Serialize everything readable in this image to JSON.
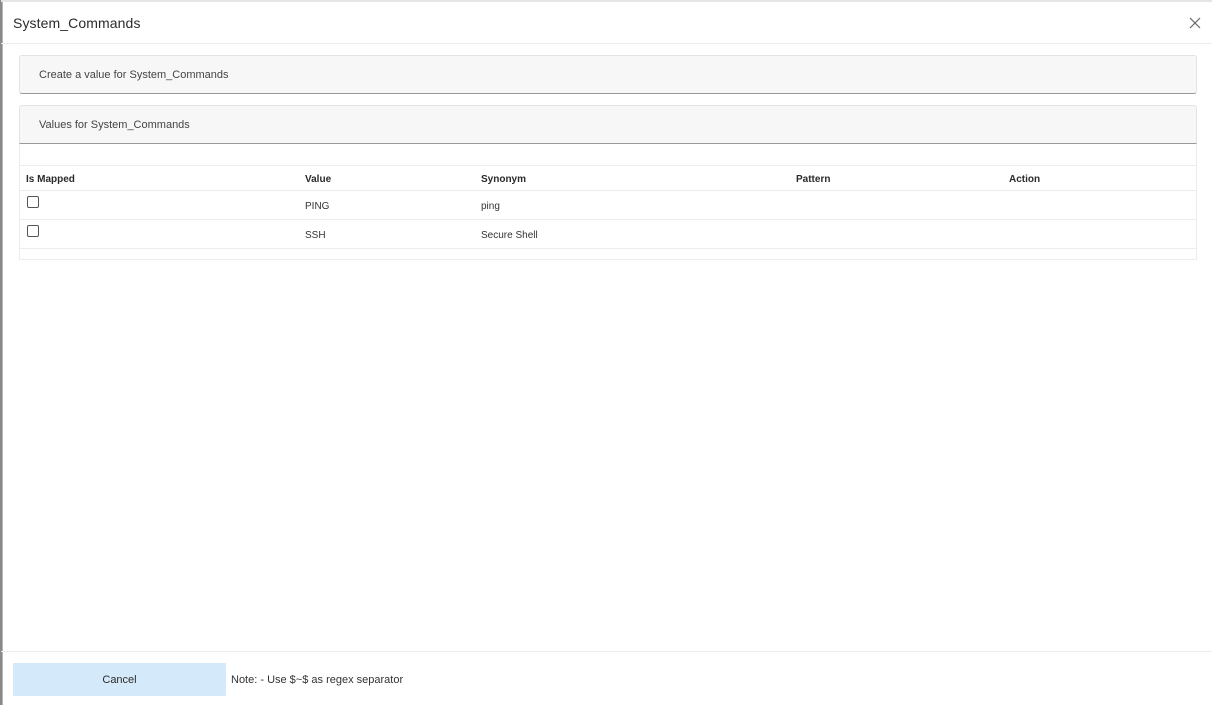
{
  "modal": {
    "title": "System_Commands",
    "close_icon": "close-icon"
  },
  "create_panel": {
    "label": "Create a value for System_Commands"
  },
  "values_panel": {
    "label": "Values for System_Commands"
  },
  "table": {
    "columns": [
      "Is Mapped",
      "Value",
      "Synonym",
      "Pattern",
      "Action"
    ],
    "rows": [
      {
        "is_mapped": false,
        "value": "PING",
        "synonym": "ping",
        "pattern": "",
        "action": ""
      },
      {
        "is_mapped": false,
        "value": "SSH",
        "synonym": "Secure Shell",
        "pattern": "",
        "action": ""
      }
    ]
  },
  "footer": {
    "cancel_label": "Cancel",
    "note": "Note: - Use $~$ as regex separator"
  },
  "colors": {
    "cancel_button_bg": "#d4e9fa",
    "panel_bg": "#f7f7f7"
  }
}
